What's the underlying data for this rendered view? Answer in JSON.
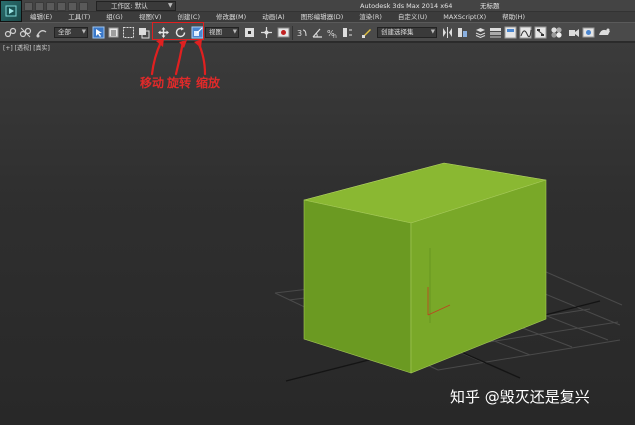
{
  "titlebar": {
    "workspace_label": "工作区: 默认",
    "app_title": "Autodesk 3ds Max  2014 x64",
    "doc_title": "无标题"
  },
  "menu": {
    "items": [
      "编辑(E)",
      "工具(T)",
      "组(G)",
      "视图(V)",
      "创建(C)",
      "修改器(M)",
      "动画(A)",
      "图形编辑器(D)",
      "渲染(R)",
      "自定义(U)",
      "MAXScript(X)",
      "帮助(H)"
    ]
  },
  "toolbar": {
    "selection_filter": "全部",
    "reference_coord": "视图",
    "named_selection": "创建选择集"
  },
  "viewport": {
    "label": "[+] [透视] [真实]"
  },
  "annotations": {
    "move": "移动",
    "rotate": "旋转",
    "scale": "缩放"
  },
  "watermark": "知乎 @毁灭还是复兴",
  "colors": {
    "box_front": "#6b9a22",
    "box_top": "#8ab832",
    "box_side": "#79a828",
    "annotation": "#e02020"
  }
}
